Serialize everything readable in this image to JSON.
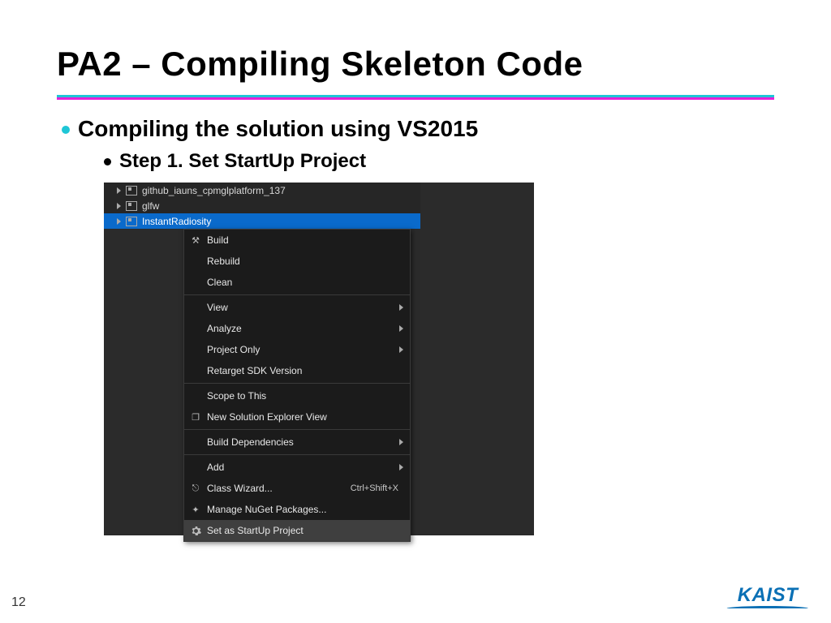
{
  "title": "PA2 – Compiling Skeleton Code",
  "bullet1": "Compiling the solution using VS2015",
  "bullet2": "Step 1. Set StartUp Project",
  "explorer": {
    "nodes": [
      {
        "label": "github_iauns_cpmglplatform_137"
      },
      {
        "label": "glfw"
      },
      {
        "label": "InstantRadiosity"
      }
    ]
  },
  "menu": {
    "items": [
      {
        "label": "Build",
        "icon": "build"
      },
      {
        "label": "Rebuild"
      },
      {
        "label": "Clean"
      },
      {
        "sep": true
      },
      {
        "label": "View",
        "sub": true
      },
      {
        "label": "Analyze",
        "sub": true
      },
      {
        "label": "Project Only",
        "sub": true
      },
      {
        "label": "Retarget SDK Version"
      },
      {
        "sep": true
      },
      {
        "label": "Scope to This"
      },
      {
        "label": "New Solution Explorer View",
        "icon": "window"
      },
      {
        "sep": true
      },
      {
        "label": "Build Dependencies",
        "sub": true
      },
      {
        "sep": true
      },
      {
        "label": "Add",
        "sub": true
      },
      {
        "label": "Class Wizard...",
        "shortcut": "Ctrl+Shift+X",
        "icon": "wizard"
      },
      {
        "label": "Manage NuGet Packages...",
        "icon": "package"
      },
      {
        "label": "Set as StartUp Project",
        "icon": "gear",
        "hover": true
      }
    ]
  },
  "page_number": "12",
  "logo": "KAIST"
}
